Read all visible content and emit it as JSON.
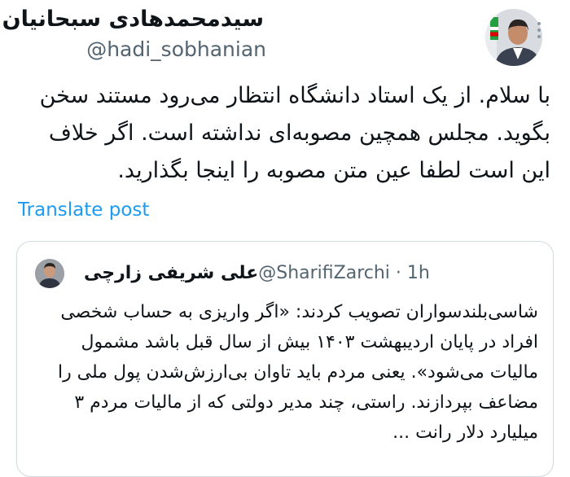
{
  "author": {
    "display_name": "سیدمحمدهادی سبحانیان",
    "handle": "@hadi_sobhanian"
  },
  "post": {
    "text": "با سلام. از یک استاد دانشگاه انتظار می‌رود مستند سخن بگوید. مجلس همچین مصوبه‌ای نداشته است. اگر خلاف این است لطفا عین متن مصوبه را اینجا بگذارید.",
    "translate_label": "Translate post"
  },
  "quoted": {
    "display_name": "علی شریفی زارچی",
    "handle_time": "@SharifiZarchi · 1h",
    "text": "شاسی‌بلندسواران تصویب کردند: «اگر واریزی به حساب شخصی افراد در پایان اردیبهشت ۱۴۰۳ بیش از سال قبل باشد مشمول مالیات می‌شود». یعنی مردم باید تاوان بی‌ارزش‌شدن پول ملی را مضاعف بپردازند. راستی، چند مدیر دولتی که از مالیات مردم ۳ میلیارد دلار رانت ..."
  },
  "icons": {
    "more": "more-vertical-icon"
  },
  "colors": {
    "link": "#1d9bf0",
    "secondary_text": "#536471",
    "border": "#cfd9de"
  }
}
